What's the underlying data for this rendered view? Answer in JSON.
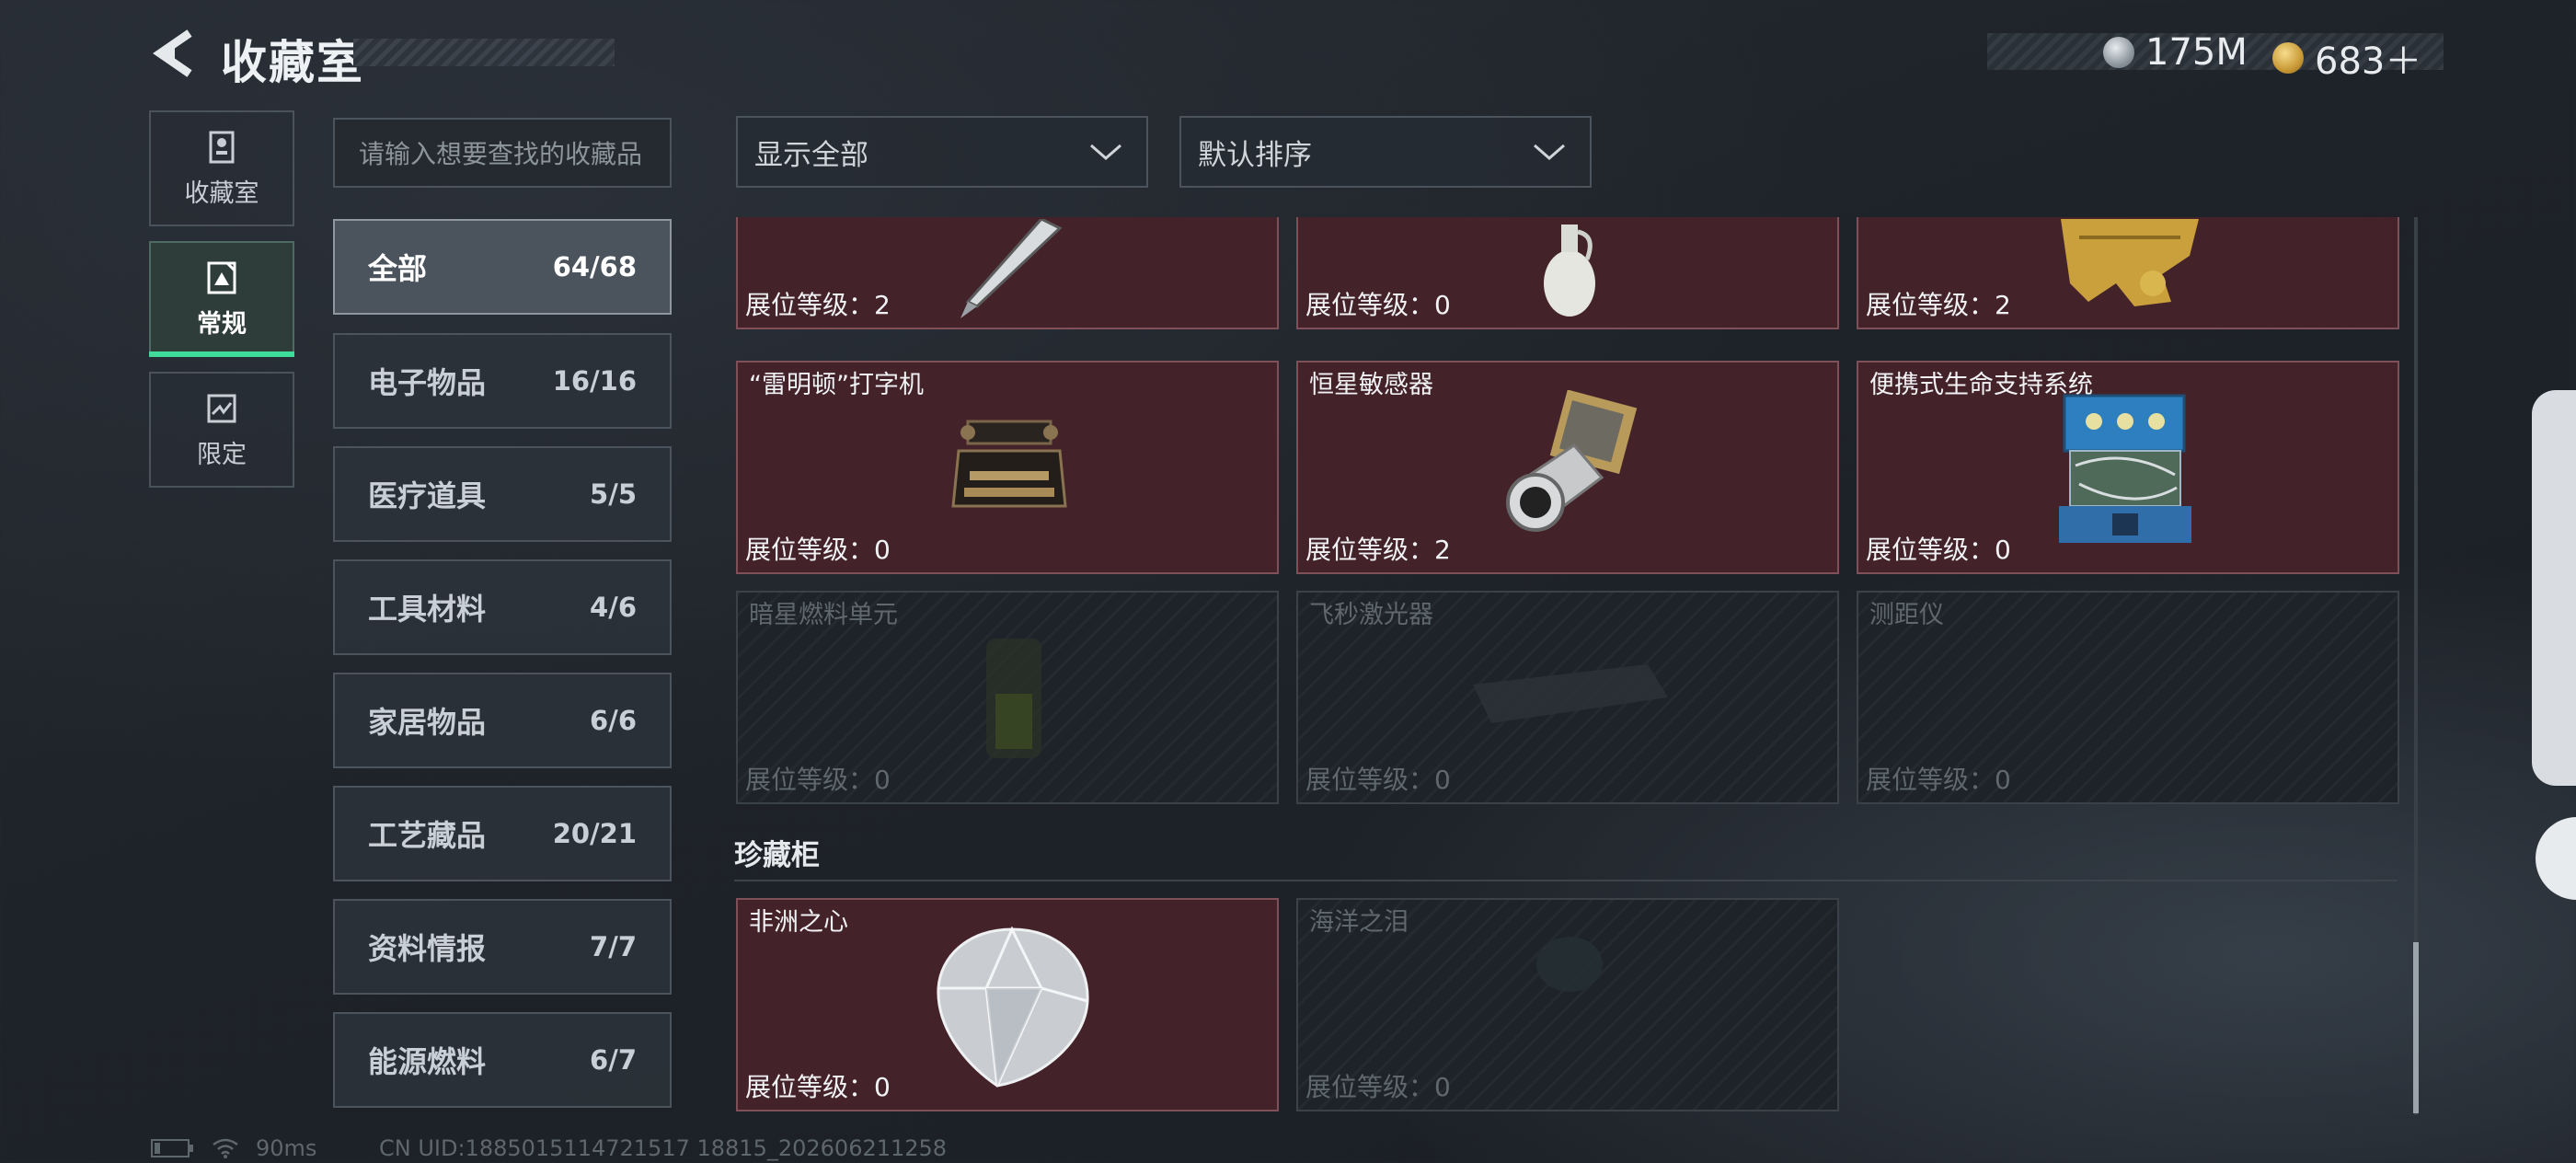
{
  "header": {
    "title": "收藏室",
    "currency": [
      {
        "icon": "silver-coin-icon",
        "value": "175M"
      },
      {
        "icon": "gold-coin-icon",
        "value": "683＋"
      }
    ]
  },
  "mode_tabs": [
    {
      "label": "收藏室",
      "icon": "trophy-cabinet-icon",
      "active": false
    },
    {
      "label": "常规",
      "icon": "document-icon",
      "active": true
    },
    {
      "label": "限定",
      "icon": "limited-icon",
      "active": false
    }
  ],
  "search": {
    "placeholder": "请输入想要查找的收藏品"
  },
  "filters": {
    "display": "显示全部",
    "sort": "默认排序"
  },
  "categories": [
    {
      "name": "全部",
      "count": "64/68",
      "active": true
    },
    {
      "name": "电子物品",
      "count": "16/16"
    },
    {
      "name": "医疗道具",
      "count": "5/5"
    },
    {
      "name": "工具材料",
      "count": "4/6"
    },
    {
      "name": "家居物品",
      "count": "6/6"
    },
    {
      "name": "工艺藏品",
      "count": "20/21"
    },
    {
      "name": "资料情报",
      "count": "7/7"
    },
    {
      "name": "能源燃料",
      "count": "6/7"
    }
  ],
  "items": [
    {
      "name": "",
      "level": "展位等级：2",
      "collected": true,
      "art": "fountain-pen"
    },
    {
      "name": "",
      "level": "展位等级：0",
      "collected": true,
      "art": "white-vase"
    },
    {
      "name": "",
      "level": "展位等级：2",
      "collected": true,
      "art": "golden-statue"
    },
    {
      "name": "“雷明顿”打字机",
      "level": "展位等级：0",
      "collected": true,
      "art": "typewriter"
    },
    {
      "name": "恒星敏感器",
      "level": "展位等级：2",
      "collected": true,
      "art": "star-sensor"
    },
    {
      "name": "便携式生命支持系统",
      "level": "展位等级：0",
      "collected": true,
      "art": "life-support"
    },
    {
      "name": "暗星燃料单元",
      "level": "展位等级：0",
      "collected": false,
      "art": "fuel-cell"
    },
    {
      "name": "飞秒激光器",
      "level": "展位等级：0",
      "collected": false,
      "art": "laser"
    },
    {
      "name": "测距仪",
      "level": "展位等级：0",
      "collected": false,
      "art": "rangefinder"
    }
  ],
  "section": {
    "title": "珍藏柜",
    "items": [
      {
        "name": "非洲之心",
        "level": "展位等级：0",
        "collected": true,
        "art": "diamond"
      },
      {
        "name": "海洋之泪",
        "level": "展位等级：0",
        "collected": false,
        "art": "gem"
      }
    ]
  },
  "footer": {
    "ping": "90ms",
    "uid": "CN UID:1885015114721517 18815_202606211258"
  }
}
